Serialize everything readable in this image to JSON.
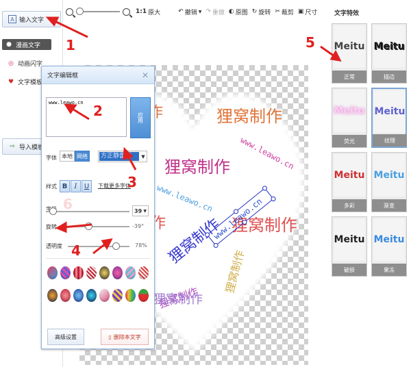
{
  "sidebar": {
    "input_text": "输入文字",
    "items": [
      {
        "label": "漫画文字"
      },
      {
        "label": "动画闪字"
      },
      {
        "label": "文字模板"
      }
    ],
    "import_template": "导入模板"
  },
  "toolbar": {
    "zoom_reset": "1:1",
    "zoom_original": "原大",
    "undo": "撤销",
    "redo": "重做",
    "original": "原图",
    "rotate": "旋转",
    "crop": "裁剪",
    "size": "尺寸"
  },
  "dialog": {
    "title": "文字编辑框",
    "text_value": "www.leawo.cn",
    "apply": "应用",
    "font_label": "字体",
    "font_local": "本地",
    "font_online": "网络",
    "font_name": "方正静蕾简",
    "style_label": "样式",
    "bold": "B",
    "italic": "I",
    "underline": "U",
    "download_fonts": "下载更多字体",
    "size_label": "字号",
    "size_value": "39",
    "rotate_label": "旋转",
    "rotate_value": "-39°",
    "rotate_fraction": 0.39,
    "opacity_label": "透明度",
    "opacity_value": "78%",
    "opacity_fraction": 0.78,
    "size_fraction": 0.08,
    "advanced": "高级设置",
    "delete_text": "删除本文字"
  },
  "effects": {
    "title": "文字特效",
    "items": [
      {
        "preview": "Meitu",
        "label": "正常",
        "color": "#444444"
      },
      {
        "preview": "Meitu",
        "label": "描边",
        "color": "#111111"
      },
      {
        "preview": "Meitu",
        "label": "荧光",
        "color": "#f0a8e0"
      },
      {
        "preview": "Meitu",
        "label": "纹理",
        "color": "#6060d0"
      },
      {
        "preview": "Meitu",
        "label": "多彩",
        "color": "#d03030"
      },
      {
        "preview": "Meitu",
        "label": "渐变",
        "color": "#4aa0e0"
      },
      {
        "preview": "Meitu",
        "label": "破损",
        "color": "#222222"
      },
      {
        "preview": "Meitu",
        "label": "果冻",
        "color": "#3a8ae0"
      }
    ]
  },
  "canvas": {
    "texts": [
      {
        "text": "狸窝制作",
        "color": "#e0743a"
      },
      {
        "text": "狸窝制作",
        "color": "#c0308a"
      },
      {
        "text": "狸窝制作",
        "color": "#e05050"
      },
      {
        "text": "狸窝制作",
        "color": "#3a3ad0"
      },
      {
        "text": "狸窝制作",
        "color": "#b050c0"
      },
      {
        "text": "狸窝制作",
        "color": "#a07ad0"
      },
      {
        "text": "狸窝制作",
        "color": "#d0b050"
      },
      {
        "text": "www.leawo.cn",
        "color": "#d040a0"
      },
      {
        "text": "www.leawo.cn",
        "color": "#3050d0"
      },
      {
        "text": "www.leawo.cn",
        "color": "#50a0e0"
      },
      {
        "text": "作",
        "color": "#e0743a"
      },
      {
        "text": "作",
        "color": "#e05050"
      }
    ]
  },
  "annotations": [
    "1",
    "2",
    "3",
    "4",
    "5",
    "6"
  ],
  "colors": {
    "accent": "#4a8ad3",
    "annotation": "#e02020"
  }
}
